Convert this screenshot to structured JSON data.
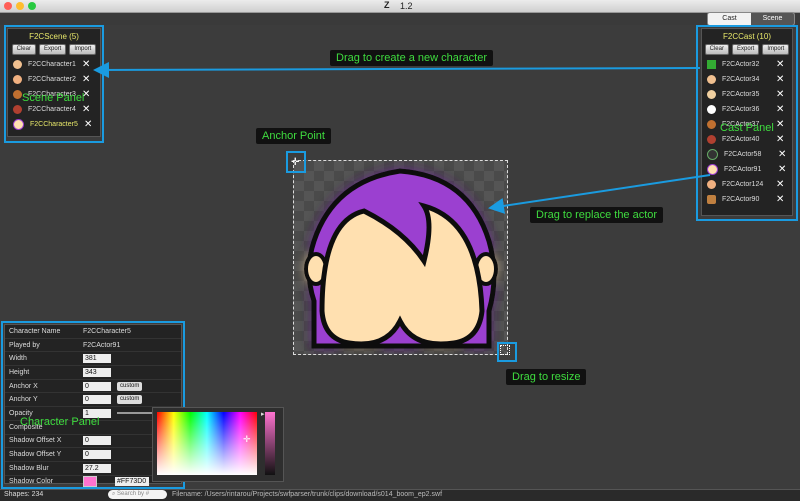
{
  "window": {
    "title": "1.2"
  },
  "toolbar": {
    "cast_label": "Cast",
    "scene_label": "Scene"
  },
  "scene_panel": {
    "title": "F2CScene  (5)",
    "buttons": {
      "clear": "Clear",
      "export": "Export",
      "import": "Import"
    },
    "items": [
      {
        "label": "F2CCharacter1"
      },
      {
        "label": "F2CCharacter2"
      },
      {
        "label": "F2CCharacter3"
      },
      {
        "label": "F2CCharacter4"
      },
      {
        "label": "F2CCharacter5"
      }
    ]
  },
  "cast_panel": {
    "title": "F2CCast  (10)",
    "buttons": {
      "clear": "Clear",
      "export": "Export",
      "import": "Import"
    },
    "items": [
      {
        "label": "F2CActor32"
      },
      {
        "label": "F2CActor34"
      },
      {
        "label": "F2CActor35"
      },
      {
        "label": "F2CActor36"
      },
      {
        "label": "F2CActor37"
      },
      {
        "label": "F2CActor40"
      },
      {
        "label": "F2CActor58"
      },
      {
        "label": "F2CActor91"
      },
      {
        "label": "F2CActor124"
      },
      {
        "label": "F2CActor90"
      }
    ]
  },
  "annotations": {
    "create": "Drag to create a new character",
    "scene_panel": "Scene Panel",
    "cast_panel": "Cast Panel",
    "anchor": "Anchor Point",
    "replace": "Drag to replace the actor",
    "resize": "Drag to resize",
    "character_panel": "Character Panel"
  },
  "character_panel": {
    "rows": [
      {
        "key": "Character Name",
        "value": "F2CCharacter5"
      },
      {
        "key": "Played by",
        "value": "F2CActor91"
      },
      {
        "key": "Width",
        "value": "381"
      },
      {
        "key": "Height",
        "value": "343"
      },
      {
        "key": "Anchor X",
        "value": "0",
        "popup": "custom"
      },
      {
        "key": "Anchor Y",
        "value": "0",
        "popup": "custom"
      },
      {
        "key": "Opacity",
        "value": "1"
      },
      {
        "key": "Composite",
        "value": ""
      },
      {
        "key": "Shadow Offset X",
        "value": "0"
      },
      {
        "key": "Shadow Offset Y",
        "value": "0"
      },
      {
        "key": "Shadow Blur",
        "value": "27.2"
      },
      {
        "key": "Shadow Color",
        "value": "#FF73D0"
      }
    ]
  },
  "status": {
    "shapes": "Shapes: 234",
    "search_placeholder": "Search by #",
    "filename": "Filename: /Users/rintarou/Projects/swfparser/trunk/clips/download/s014_boom_ep2.swf"
  },
  "colors": {
    "accent": "#1a9be0",
    "callout_text": "#3fdc3f",
    "panel_title": "#e8e86a",
    "hair": "#9b3fd0",
    "face": "#ffe0b0",
    "shadow": "#ff73d0"
  }
}
